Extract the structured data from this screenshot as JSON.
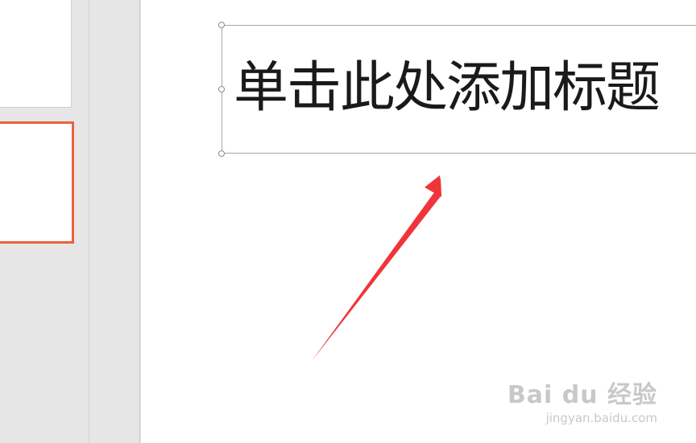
{
  "slide": {
    "title_placeholder": "单击此处添加标题"
  },
  "watermark": {
    "logo": "Bai du 经验",
    "url": "jingyan.baidu.com"
  },
  "colors": {
    "selected_thumb_border": "#e8623f",
    "arrow": "#f0353a",
    "pane_background": "#e6e6e6",
    "slide_background": "#ffffff"
  },
  "icons": {
    "annotation": "red-arrow-icon",
    "resize_handles": "resize-handle-icon"
  }
}
